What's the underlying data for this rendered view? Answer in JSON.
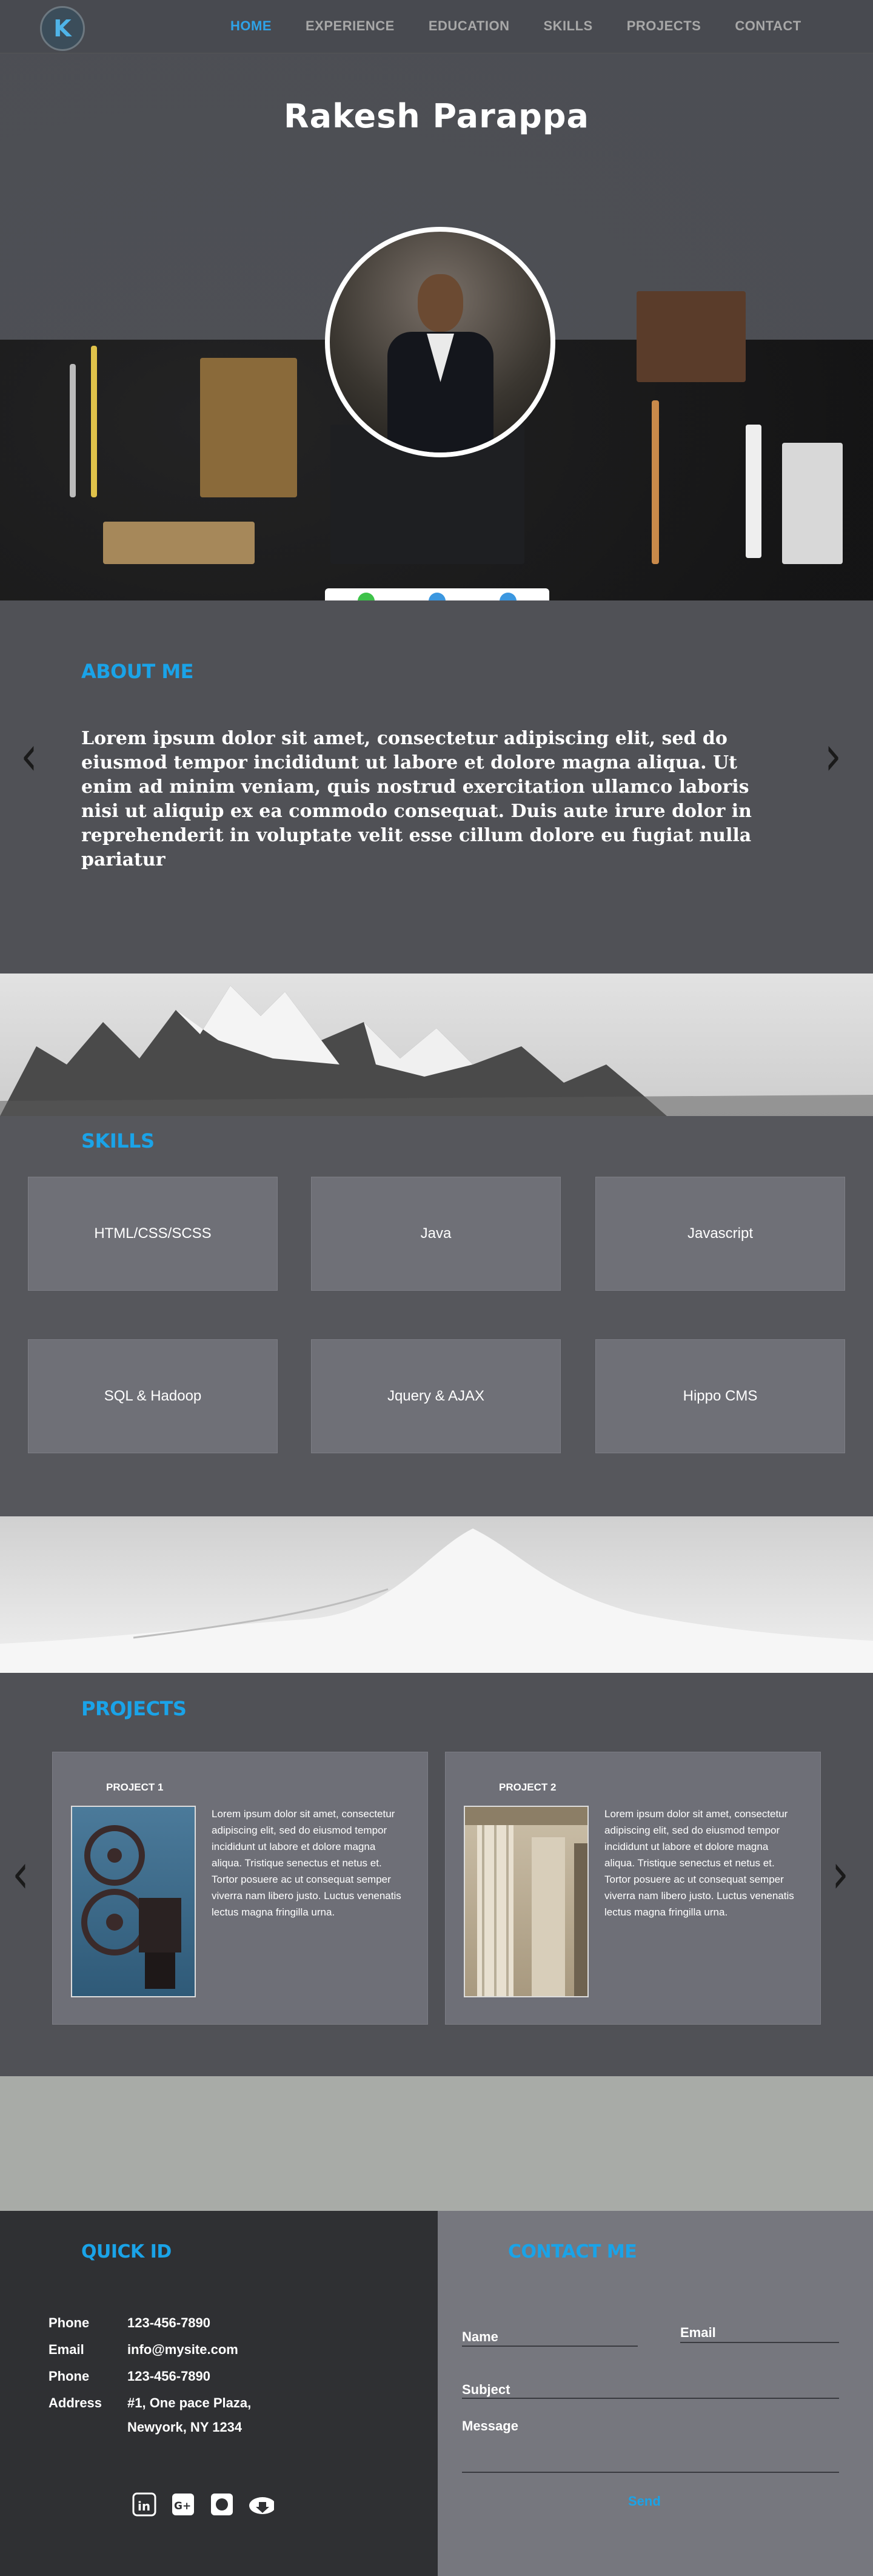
{
  "nav": {
    "logo_letter": "K",
    "items": [
      {
        "label": "HOME",
        "active": true
      },
      {
        "label": "EXPERIENCE",
        "active": false
      },
      {
        "label": "EDUCATION",
        "active": false
      },
      {
        "label": "SKILLS",
        "active": false
      },
      {
        "label": "PROJECTS",
        "active": false
      },
      {
        "label": "CONTACT",
        "active": false
      }
    ]
  },
  "hero": {
    "name": "Rakesh Parappa"
  },
  "about": {
    "title": "ABOUT ME",
    "text": "Lorem ipsum dolor sit amet, consectetur adipiscing elit, sed do eiusmod tempor incididunt ut labore et dolore magna aliqua. Ut enim ad minim veniam, quis nostrud exercitation ullamco laboris nisi ut aliquip ex ea commodo consequat. Duis aute irure dolor in reprehenderit in voluptate velit esse cillum dolore eu fugiat nulla pariatur",
    "prev_arrow": "‹",
    "next_arrow": "›"
  },
  "skills": {
    "title": "SKILLS",
    "items": [
      "HTML/CSS/SCSS",
      "Java",
      "Javascript",
      "SQL & Hadoop",
      "Jquery & AJAX",
      "Hippo CMS"
    ]
  },
  "projects": {
    "title": "PROJECTS",
    "items": [
      {
        "title": "PROJECT 1",
        "image": "film-projector",
        "description": "Lorem ipsum dolor sit amet, consectetur adipiscing elit, sed do eiusmod tempor incididunt ut labore et dolore magna aliqua. Tristique senectus et netus et. Tortor posuere ac ut consequat semper viverra nam libero justo. Luctus venenatis lectus magna fringilla urna."
      },
      {
        "title": "PROJECT 2",
        "image": "greek-columns",
        "description": "Lorem ipsum dolor sit amet, consectetur adipiscing elit, sed do eiusmod tempor incididunt ut labore et dolore magna aliqua. Tristique senectus et netus et. Tortor posuere ac ut consequat semper viverra nam libero justo. Luctus venenatis lectus magna fringilla urna."
      }
    ],
    "prev_arrow": "‹",
    "next_arrow": "›"
  },
  "quick_id": {
    "title": "QUICK ID",
    "rows": [
      {
        "key": "Phone",
        "value": "123-456-7890"
      },
      {
        "key": "Email",
        "value": "info@mysite.com"
      },
      {
        "key": "Phone",
        "value": "123-456-7890"
      },
      {
        "key": "Address",
        "value": "#1, One pace Plaza,"
      },
      {
        "key": "",
        "value": "Newyork, NY 1234"
      }
    ],
    "social": [
      "linkedin-icon",
      "google-plus-icon",
      "github-icon",
      "download-cloud-icon"
    ]
  },
  "contact": {
    "title": "CONTACT ME",
    "name_label": "Name",
    "email_label": "Email",
    "subject_label": "Subject",
    "message_label": "Message",
    "send_label": "Send"
  },
  "colors": {
    "accent": "#1aa3e8",
    "active_dot": "#3ec24a",
    "dot": "#3b97e0"
  }
}
